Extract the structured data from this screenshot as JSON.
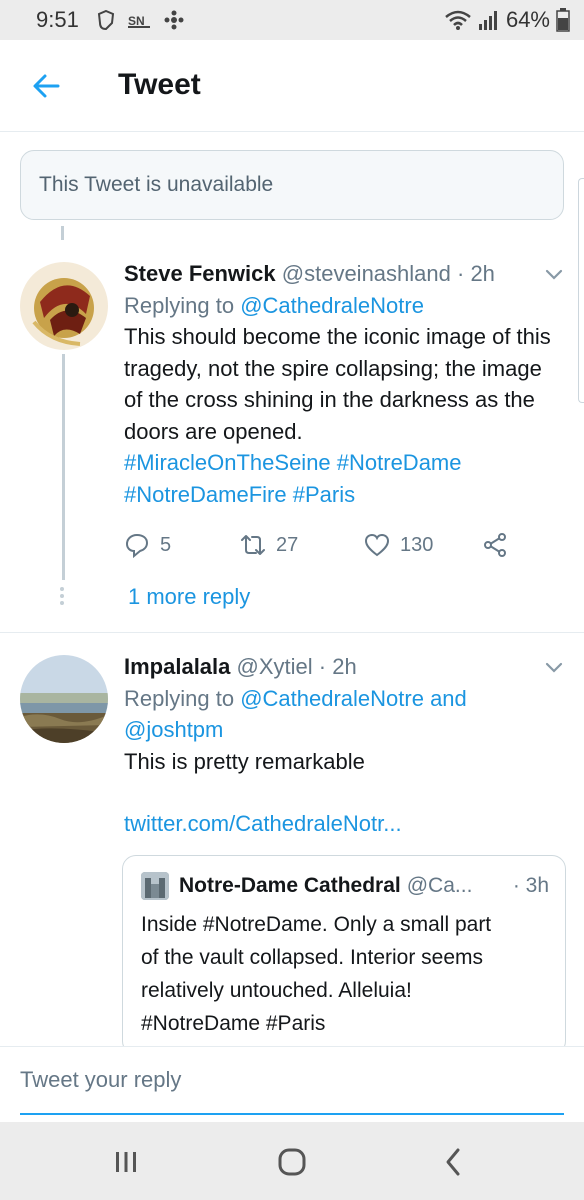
{
  "status_bar": {
    "time": "9:51",
    "battery": "64%",
    "icons": [
      "nhl-icon",
      "sportsnet-icon",
      "cbc-icon",
      "wifi-icon",
      "signal-icon",
      "battery-icon"
    ]
  },
  "header": {
    "title": "Tweet",
    "back_icon": "arrow-left-icon"
  },
  "unavailable": {
    "text": "This Tweet is unavailable"
  },
  "tweets": [
    {
      "name": "Steve Fenwick",
      "handle": "@steveinashland",
      "time": "· 2h",
      "replying_prefix": "Replying to ",
      "replying_to": "@CathedraleNotre",
      "text": "This should become the iconic image of this tragedy, not the spire collapsing; the image of the cross shining in the darkness as the doors are opened.",
      "hashtags_line1": "#MiracleOnTheSeine #NotreDame",
      "hashtags_line2": "#NotreDameFire #Paris",
      "replies": "5",
      "retweets": "27",
      "likes": "130",
      "more_replies": "1 more reply"
    },
    {
      "name": "Impalalala",
      "handle": "@Xytiel",
      "time": "· 2h",
      "replying_prefix": "Replying to ",
      "replying_to": "@CathedraleNotre",
      "replying_and": " and",
      "replying_to2": "@joshtpm",
      "text": "This is pretty remarkable",
      "link": "twitter.com/CathedraleNotr...",
      "quote": {
        "name": "Notre-Dame Cathedral",
        "handle": "@Ca...",
        "time": "· 3h",
        "line1": "Inside #NotreDame. Only a small part",
        "line2": "of the vault collapsed. Interior seems",
        "line3": "relatively untouched. Alleluia!",
        "line4": "#NotreDame #Paris"
      }
    }
  ],
  "reply_bar": {
    "placeholder": "Tweet your reply"
  },
  "nav_bar": {
    "icons": [
      "recents-icon",
      "home-icon",
      "back-icon"
    ]
  },
  "colors": {
    "accent": "#1b95e0",
    "text": "#14171a",
    "muted": "#657786"
  }
}
